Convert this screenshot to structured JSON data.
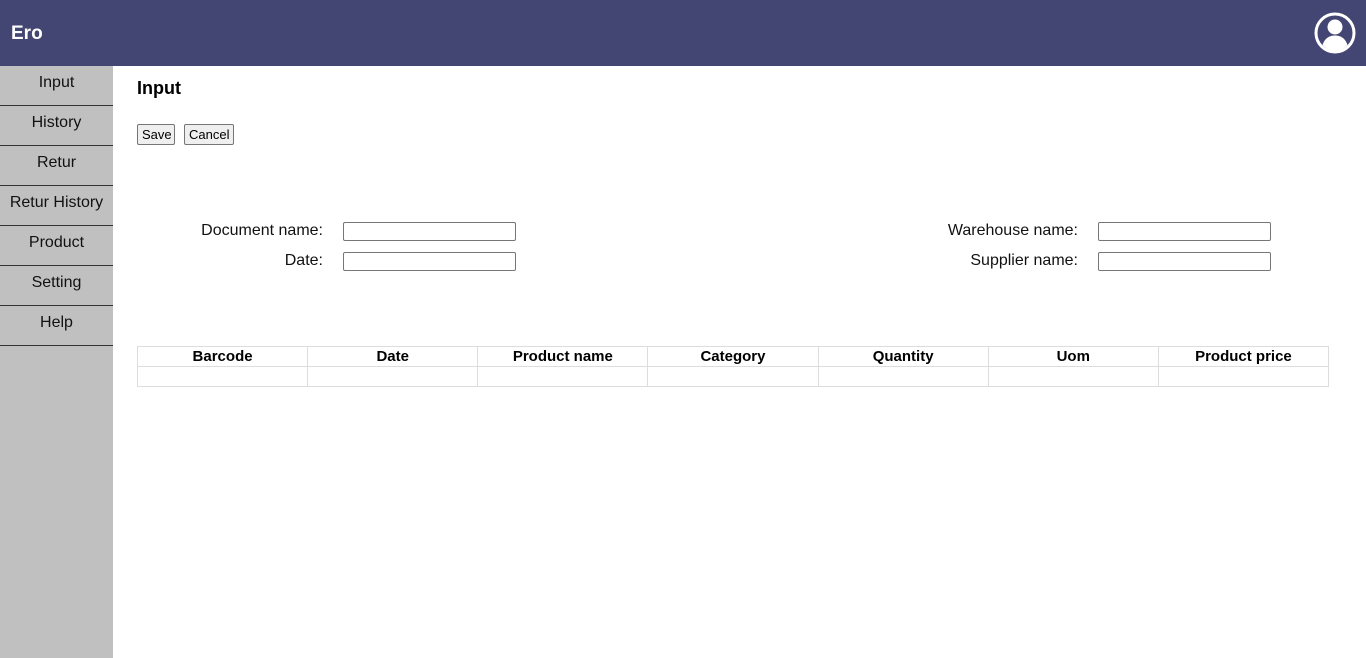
{
  "app": {
    "title": "Ero"
  },
  "header": {
    "avatar_icon": "user-circle-icon",
    "bar_color": "#434573"
  },
  "sidebar": {
    "items": [
      {
        "label": "Input"
      },
      {
        "label": "History"
      },
      {
        "label": "Retur"
      },
      {
        "label": "Retur History"
      },
      {
        "label": "Product"
      },
      {
        "label": "Setting"
      },
      {
        "label": "Help"
      }
    ]
  },
  "main": {
    "title": "Input",
    "buttons": {
      "save_label": "Save",
      "cancel_label": "Cancel"
    },
    "form": {
      "document_name_label": "Document name:",
      "document_name_value": "",
      "date_label": "Date:",
      "date_value": "",
      "warehouse_name_label": "Warehouse name:",
      "warehouse_name_value": "",
      "supplier_name_label": "Supplier name:",
      "supplier_name_value": ""
    },
    "table": {
      "columns": [
        "Barcode",
        "Date",
        "Product name",
        "Category",
        "Quantity",
        "Uom",
        "Product price"
      ],
      "rows": [
        [
          "",
          "",
          "",
          "",
          "",
          "",
          ""
        ]
      ]
    }
  }
}
